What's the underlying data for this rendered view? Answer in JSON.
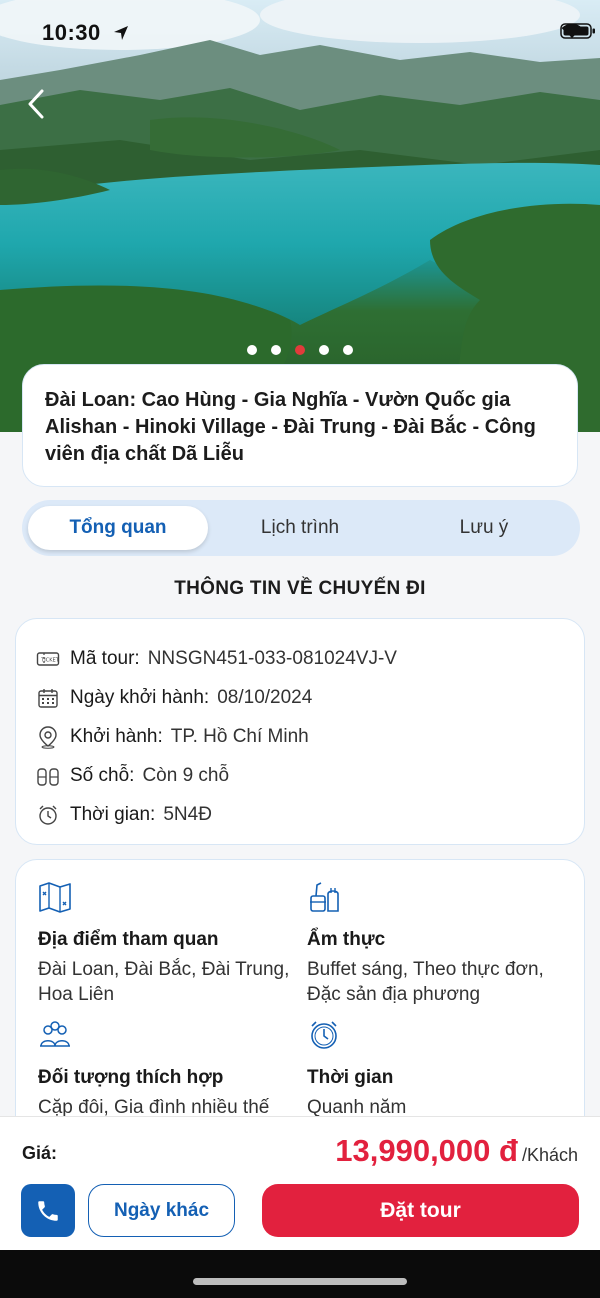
{
  "status_bar": {
    "time": "10:30"
  },
  "hero": {
    "slides": 5,
    "active_slide": 2
  },
  "tour": {
    "title": "Đài Loan: Cao Hùng - Gia Nghĩa - Vườn Quốc gia Alishan - Hinoki Village - Đài Trung - Đài Bắc - Công viên địa chất Dã Liễu"
  },
  "tabs": [
    {
      "label": "Tổng quan",
      "active": true
    },
    {
      "label": "Lịch trình",
      "active": false
    },
    {
      "label": "Lưu ý",
      "active": false
    }
  ],
  "section_title": "THÔNG TIN VỀ CHUYẾN ĐI",
  "info": [
    {
      "icon": "ticket-icon",
      "label": "Mã tour:",
      "value": "NNSGN451-033-081024VJ-V"
    },
    {
      "icon": "calendar-icon",
      "label": "Ngày khởi hành:",
      "value": "08/10/2024"
    },
    {
      "icon": "location-pin-icon",
      "label": "Khởi hành:",
      "value": "TP. Hồ Chí Minh"
    },
    {
      "icon": "seats-icon",
      "label": "Số chỗ:",
      "value": "Còn 9 chỗ"
    },
    {
      "icon": "alarm-clock-icon",
      "label": "Thời gian:",
      "value": "5N4Đ"
    }
  ],
  "features": [
    {
      "icon": "map-icon",
      "title": "Địa điểm tham quan",
      "value": "Đài Loan, Đài Bắc, Đài Trung, Hoa Liên"
    },
    {
      "icon": "food-icon",
      "title": "Ẩm thực",
      "value": "Buffet sáng, Theo thực đơn, Đặc sản địa phương"
    },
    {
      "icon": "people-icon",
      "title": "Đối tượng thích hợp",
      "value": "Cặp đôi, Gia đình nhiều thế hệ, Thanh niên"
    },
    {
      "icon": "clock-icon",
      "title": "Thời gian",
      "value": "Quanh năm"
    }
  ],
  "footer": {
    "price_label": "Giá:",
    "price": "13,990,000 đ",
    "price_unit": "/Khách",
    "other_dates_label": "Ngày khác",
    "book_label": "Đặt tour"
  },
  "colors": {
    "primary": "#1460b4",
    "accent": "#e2213e"
  }
}
